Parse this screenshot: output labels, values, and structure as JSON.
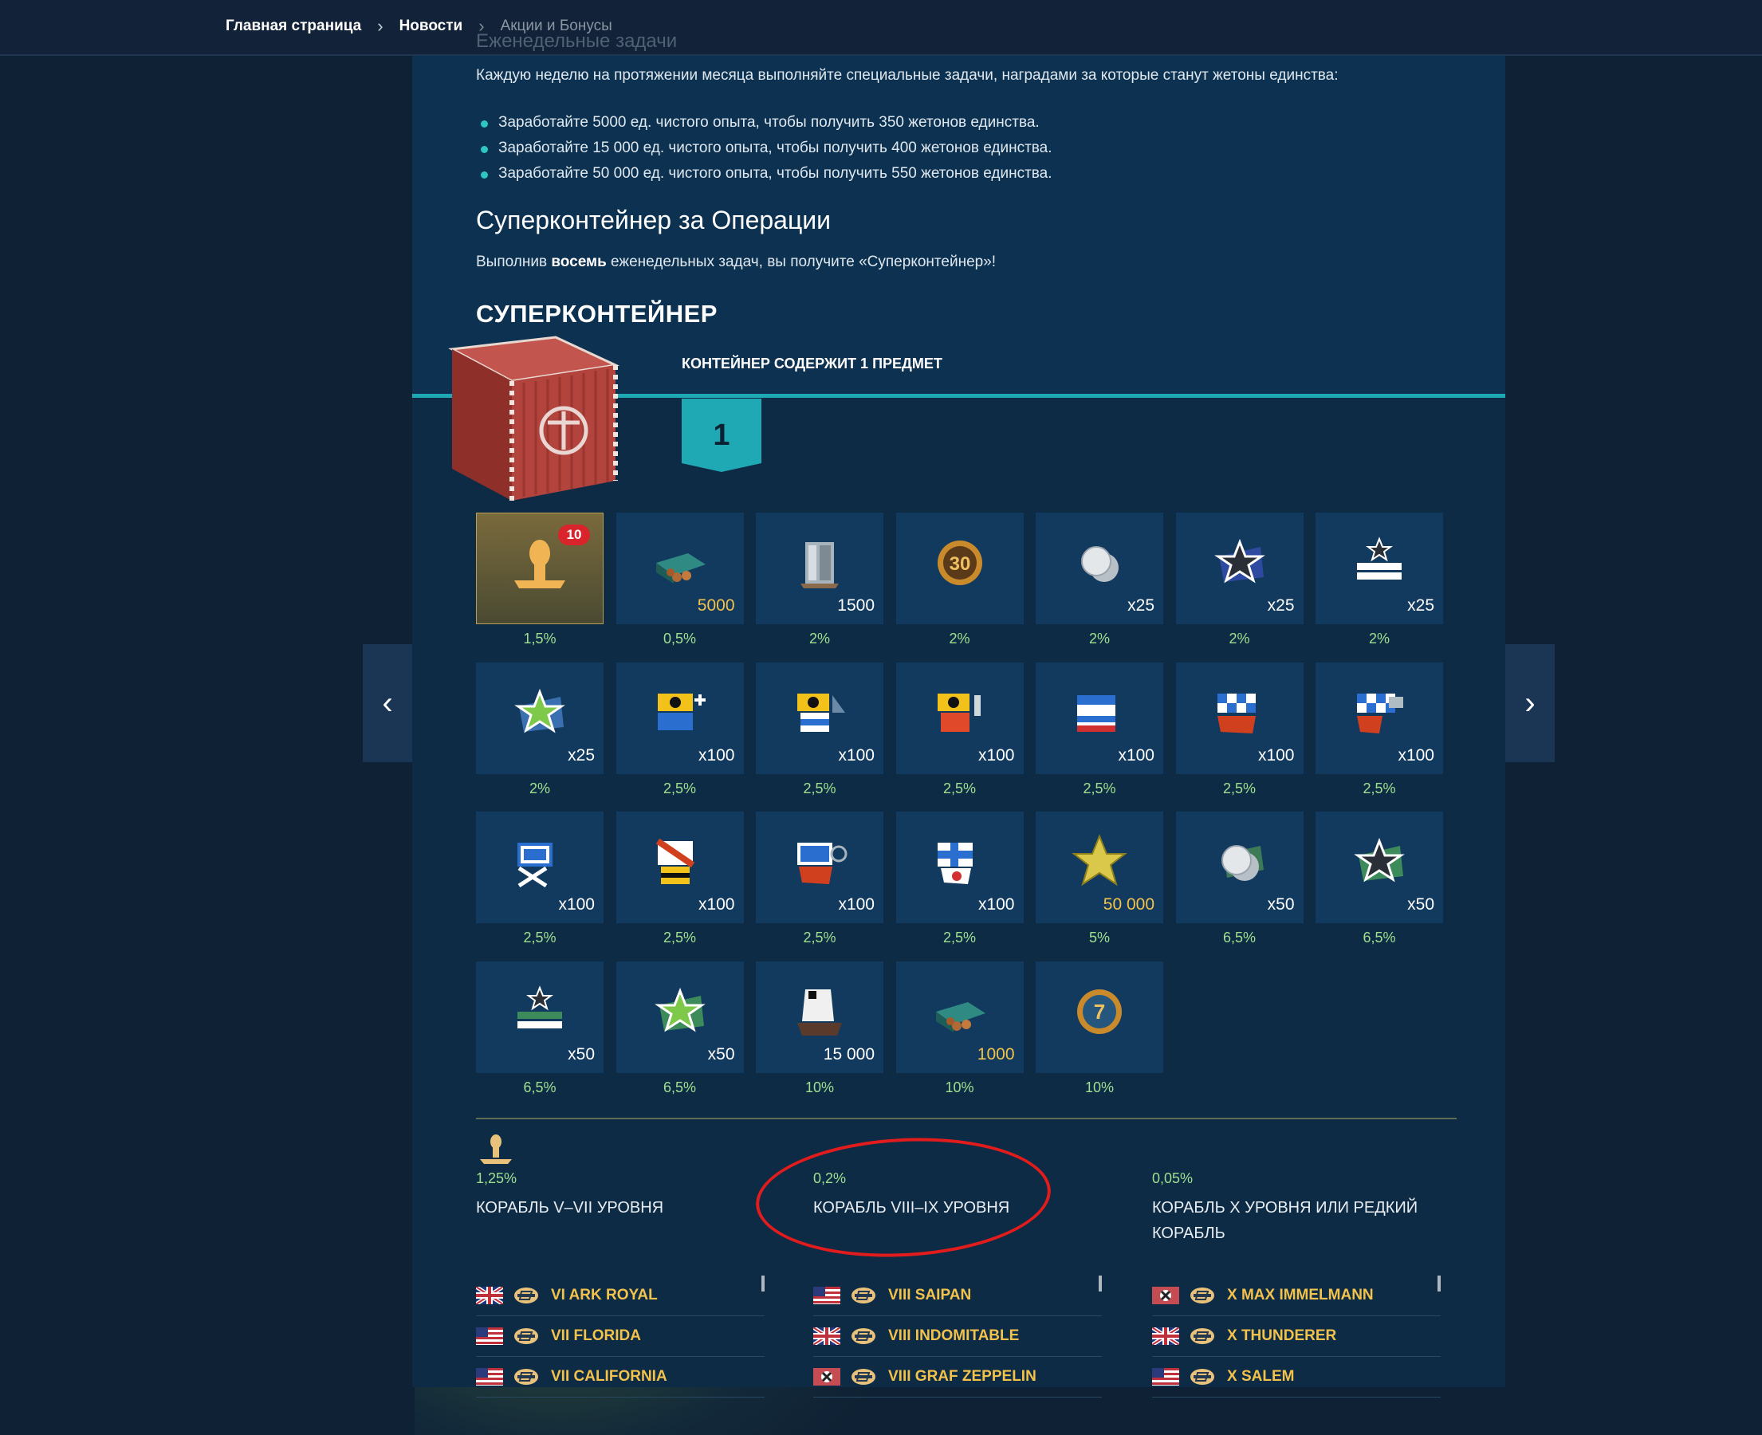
{
  "breadcrumb": {
    "items": [
      "Главная страница",
      "Новости",
      "Акции и Бонусы"
    ]
  },
  "weekly": {
    "heading_ghost": "Еженедельные задачи",
    "intro": "Каждую неделю на протяжении месяца выполняйте специальные задачи, наградами за которые станут жетоны единства:",
    "tasks": [
      "Заработайте 5000 ед. чистого опыта, чтобы получить 350 жетонов единства.",
      "Заработайте 15 000 ед. чистого опыта, чтобы получить 400 жетонов единства.",
      "Заработайте 50 000 ед. чистого опыта, чтобы получить 550 жетонов единства."
    ]
  },
  "supercontainer_section": {
    "title": "Суперконтейнер за Операции",
    "text_before": "Выполнив ",
    "text_bold": "восемь",
    "text_after": " еженедельных задач, вы получите «Суперконтейнер»!"
  },
  "container": {
    "title": "СУПЕРКОНТЕЙНЕР",
    "contains_label": "КОНТЕЙНЕР СОДЕРЖИТ 1 ПРЕДМЕТ",
    "count": "1"
  },
  "rewards": [
    {
      "icon": "ship-silhouette-icon",
      "qty": "",
      "badge": "10",
      "pct": "1,5%",
      "gold": true
    },
    {
      "icon": "coal-crate-icon",
      "qty": "5000",
      "pct": "0,5%",
      "qty_gold": true
    },
    {
      "icon": "steel-icon",
      "qty": "1500",
      "pct": "2%"
    },
    {
      "icon": "premium-30-icon",
      "qty": "",
      "pct": "2%"
    },
    {
      "icon": "silver-coins-icon",
      "qty": "x25",
      "pct": "2%"
    },
    {
      "icon": "camouflage-star-dark-icon",
      "qty": "x25",
      "pct": "2%"
    },
    {
      "icon": "camouflage-stripes-icon",
      "qty": "x25",
      "pct": "2%"
    },
    {
      "icon": "camouflage-star-green-icon",
      "qty": "x25",
      "pct": "2%"
    },
    {
      "icon": "signal-flag-plus-icon",
      "qty": "x100",
      "pct": "2,5%"
    },
    {
      "icon": "signal-flag-triangle-icon",
      "qty": "x100",
      "pct": "2,5%"
    },
    {
      "icon": "signal-flag-cylinder-icon",
      "qty": "x100",
      "pct": "2,5%"
    },
    {
      "icon": "signal-flag-blue-white-icon",
      "qty": "x100",
      "pct": "2,5%"
    },
    {
      "icon": "signal-flag-checkered-red-icon",
      "qty": "x100",
      "pct": "2,5%"
    },
    {
      "icon": "signal-flag-checkered-blue-icon",
      "qty": "x100",
      "pct": "2,5%"
    },
    {
      "icon": "signal-flag-blue-cross-icon",
      "qty": "x100",
      "pct": "2,5%"
    },
    {
      "icon": "signal-flag-red-diagonal-icon",
      "qty": "x100",
      "pct": "2,5%"
    },
    {
      "icon": "signal-flag-blue-red-icon",
      "qty": "x100",
      "pct": "2,5%"
    },
    {
      "icon": "signal-flag-white-cross-icon",
      "qty": "x100",
      "pct": "2,5%"
    },
    {
      "icon": "free-xp-star-icon",
      "qty": "50 000",
      "pct": "5%",
      "qty_gold": true
    },
    {
      "icon": "silver-coins-green-icon",
      "qty": "x50",
      "pct": "6,5%"
    },
    {
      "icon": "camouflage-star-green-dark-icon",
      "qty": "x50",
      "pct": "6,5%"
    },
    {
      "icon": "camouflage-stripes-green-icon",
      "qty": "x50",
      "pct": "6,5%"
    },
    {
      "icon": "camouflage-star-green-light-icon",
      "qty": "x50",
      "pct": "6,5%"
    },
    {
      "icon": "coal-sack-icon",
      "qty": "15 000",
      "pct": "10%"
    },
    {
      "icon": "coal-crate-icon",
      "qty": "1000",
      "pct": "10%",
      "qty_gold": true
    },
    {
      "icon": "premium-7-icon",
      "qty": "",
      "pct": "10%"
    }
  ],
  "ships": {
    "columns": [
      {
        "pct": "1,25%",
        "name": "КОРАБЛЬ V–VII УРОВНЯ",
        "list": [
          {
            "flag": "uk",
            "name": "VI ARK ROYAL"
          },
          {
            "flag": "usa",
            "name": "VII FLORIDA"
          },
          {
            "flag": "usa",
            "name": "VII CALIFORNIA"
          }
        ]
      },
      {
        "pct": "0,2%",
        "name": "КОРАБЛЬ VIII–IX УРОВНЯ",
        "list": [
          {
            "flag": "usa",
            "name": "VIII SAIPAN"
          },
          {
            "flag": "uk",
            "name": "VIII INDOMITABLE"
          },
          {
            "flag": "germany",
            "name": "VIII GRAF ZEPPELIN"
          }
        ]
      },
      {
        "pct": "0,05%",
        "name": "КОРАБЛЬ X УРОВНЯ ИЛИ РЕДКИЙ КОРАБЛЬ",
        "list": [
          {
            "flag": "germany",
            "name": "X MAX IMMELMANN"
          },
          {
            "flag": "uk",
            "name": "X THUNDERER"
          },
          {
            "flag": "usa",
            "name": "X SALEM"
          }
        ]
      }
    ]
  },
  "colors": {
    "accent_teal": "#1fa9b5",
    "percent_green": "#9fe08f",
    "ship_name_gold": "#f2c24b",
    "annotation_red": "#e21c1c"
  }
}
